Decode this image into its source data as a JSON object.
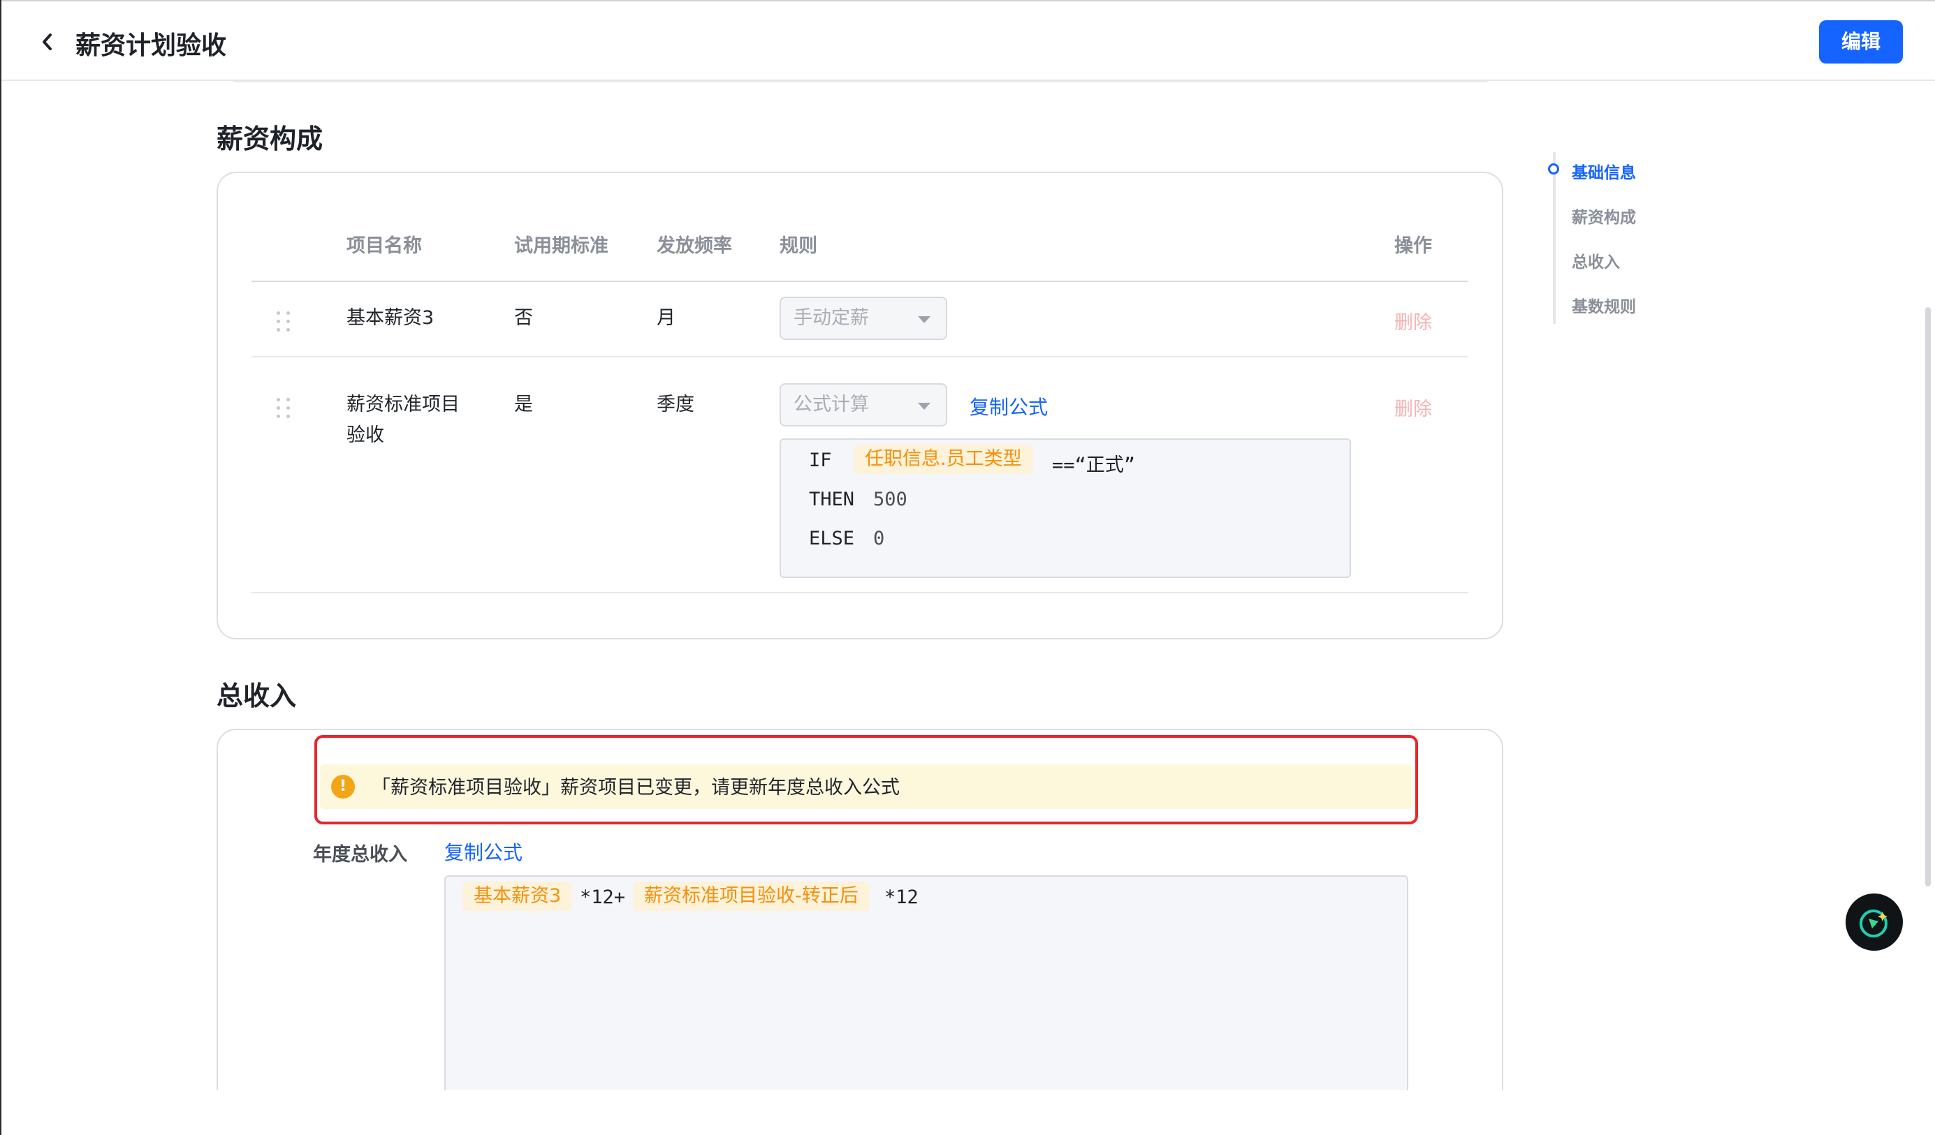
{
  "header": {
    "title": "薪资计划验收",
    "edit_label": "编辑"
  },
  "sections": {
    "composition_title": "薪资构成",
    "income_title": "总收入"
  },
  "table": {
    "columns": [
      "项目名称",
      "试用期标准",
      "发放频率",
      "规则",
      "操作"
    ],
    "rows": [
      {
        "name": "基本薪资3",
        "probation": "否",
        "frequency": "月",
        "rule": "手动定薪",
        "action": "删除"
      },
      {
        "name_line1": "薪资标准项目",
        "name_line2": "验收",
        "probation": "是",
        "frequency": "季度",
        "rule": "公式计算",
        "copy": "复制公式",
        "action": "删除",
        "formula": {
          "if_kw": "IF",
          "field": "任职信息.员工类型",
          "cond": "==“正式”",
          "then_kw": "THEN",
          "then_val": "500",
          "else_kw": "ELSE",
          "else_val": "0"
        }
      }
    ]
  },
  "anchor_nav": [
    "基础信息",
    "薪资构成",
    "总收入",
    "基数规则"
  ],
  "alert": {
    "text": "「薪资标准项目验收」薪资项目已变更，请更新年度总收入公式",
    "icon": "!"
  },
  "income": {
    "label": "年度总收入",
    "copy": "复制公式",
    "formula": {
      "token1": "基本薪资3",
      "op1": "*12+",
      "token2": "薪资标准项目验收-转正后",
      "op2": "*12"
    }
  },
  "colors": {
    "accent": "#1664ff",
    "warning": "#f4a515",
    "token_bg": "#fdf2da",
    "token_text": "#f5900a",
    "highlight": "#e5262b"
  }
}
